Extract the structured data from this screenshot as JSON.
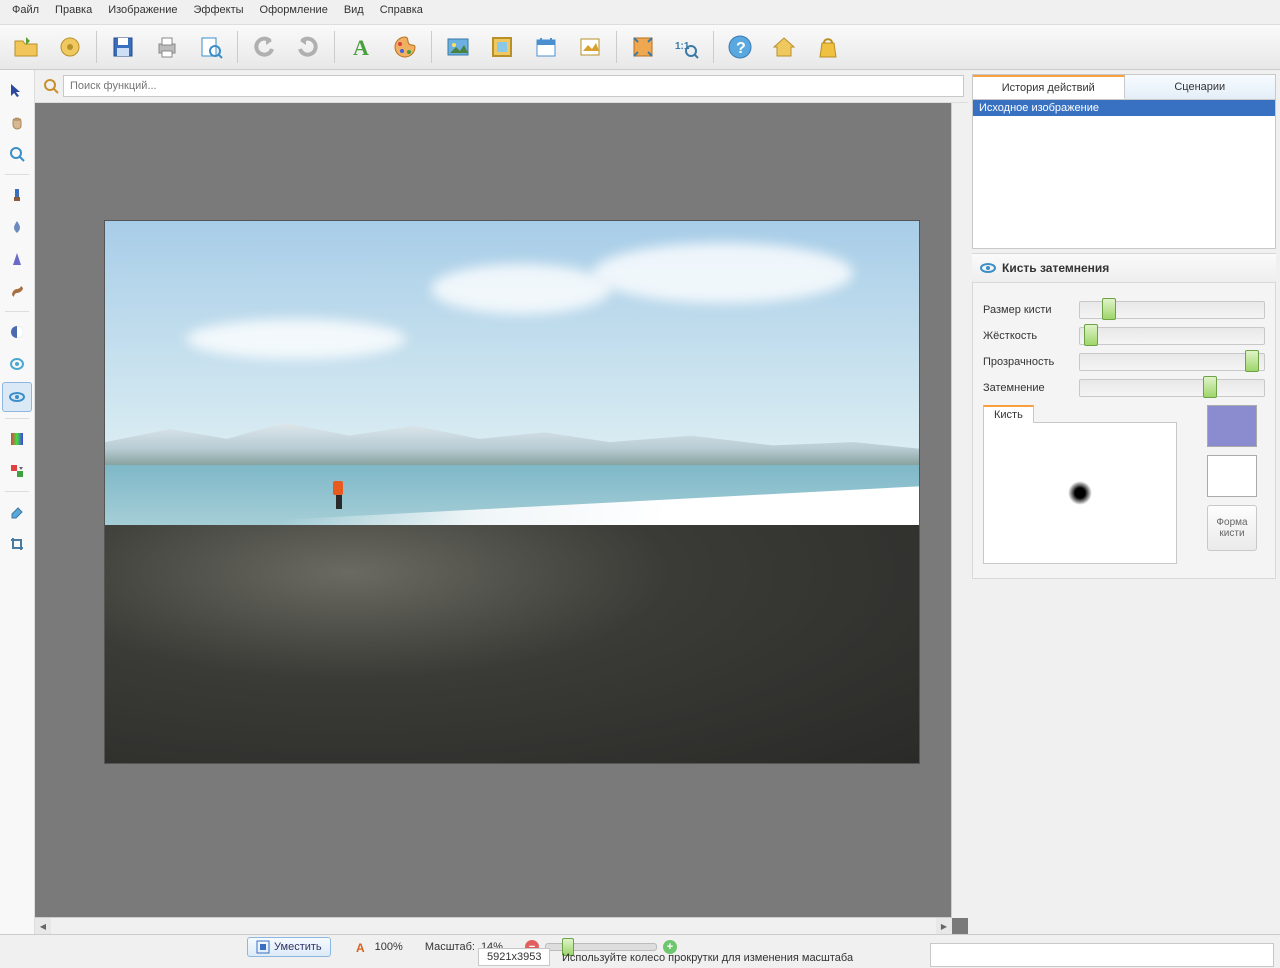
{
  "menu": [
    "Файл",
    "Правка",
    "Изображение",
    "Эффекты",
    "Оформление",
    "Вид",
    "Справка"
  ],
  "search": {
    "placeholder": "Поиск функций..."
  },
  "toolbar": [
    {
      "name": "open-icon",
      "color": "#e8b040"
    },
    {
      "name": "gear-icon",
      "color": "#d8a030"
    },
    {
      "name": "save-icon",
      "color": "#3a6fc0"
    },
    {
      "name": "print-icon",
      "color": "#888"
    },
    {
      "name": "preview-icon",
      "color": "#3a8fc8"
    },
    {
      "name": "undo-icon",
      "color": "#b0b0b0"
    },
    {
      "name": "redo-icon",
      "color": "#b0b0b0"
    },
    {
      "name": "text-icon",
      "color": "#4aa040"
    },
    {
      "name": "palette-icon",
      "color": "#d88030"
    },
    {
      "name": "image-icon",
      "color": "#4a90d0"
    },
    {
      "name": "frame-icon",
      "color": "#d8a030"
    },
    {
      "name": "calendar-icon",
      "color": "#4a90d0"
    },
    {
      "name": "picture-icon",
      "color": "#d8a030"
    },
    {
      "name": "fit-icon",
      "color": "#d88030"
    },
    {
      "name": "zoom11-icon",
      "color": "#4a90d0"
    },
    {
      "name": "help-icon",
      "color": "#4a90d0"
    },
    {
      "name": "home-icon",
      "color": "#d8a030"
    },
    {
      "name": "bag-icon",
      "color": "#d8a030"
    }
  ],
  "tools": [
    {
      "name": "pointer-icon",
      "active": false
    },
    {
      "name": "hand-icon",
      "active": false
    },
    {
      "name": "zoom-icon",
      "active": false
    },
    {
      "sep": true
    },
    {
      "name": "dropper-icon",
      "active": false
    },
    {
      "name": "blur-icon",
      "active": false
    },
    {
      "name": "sharpen-icon",
      "active": false
    },
    {
      "name": "smudge-icon",
      "active": false
    },
    {
      "sep": true
    },
    {
      "name": "dodge-icon",
      "active": false
    },
    {
      "name": "sponge-icon",
      "active": false
    },
    {
      "name": "burn-icon",
      "active": true
    },
    {
      "sep": true
    },
    {
      "name": "gradient-icon",
      "active": false
    },
    {
      "name": "replace-color-icon",
      "active": false
    },
    {
      "sep": true
    },
    {
      "name": "eraser-icon",
      "active": false
    },
    {
      "name": "crop-icon",
      "active": false
    }
  ],
  "tabs": {
    "history": "История действий",
    "scripts": "Сценарии"
  },
  "history": {
    "item": "Исходное изображение"
  },
  "panel": {
    "title": "Кисть затемнения",
    "size": "Размер кисти",
    "hardness": "Жёсткость",
    "opacity": "Прозрачность",
    "darken": "Затемнение",
    "brush_tab": "Кисть",
    "shape_btn": "Форма кисти",
    "sliders": {
      "size": 12,
      "hardness": 2,
      "opacity": 96,
      "darken": 70
    }
  },
  "status": {
    "fit": "Уместить",
    "zoom_text": "100%",
    "scale_label": "Масштаб:",
    "scale_value": "14%",
    "dims": "5921x3953",
    "hint": "Используйте колесо прокрутки для изменения масштаба"
  }
}
